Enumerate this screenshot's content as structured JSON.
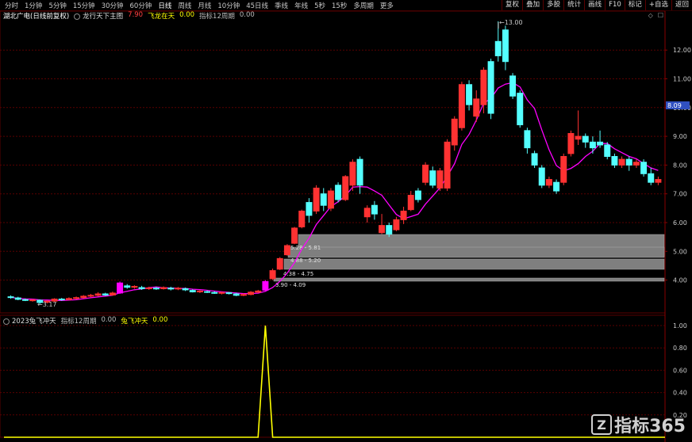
{
  "toolbar": {
    "periods": [
      "分时",
      "1分钟",
      "5分钟",
      "15分钟",
      "30分钟",
      "60分钟",
      "日线",
      "周线",
      "月线",
      "10分钟",
      "45日线",
      "季线",
      "年线",
      "5秒",
      "15秒",
      "多周期",
      "更多"
    ],
    "active_period": "日线",
    "right_buttons": [
      "复权",
      "叠加",
      "多股",
      "统计",
      "画线",
      "F10",
      "标记",
      "+自选",
      "返回"
    ]
  },
  "main_legend": {
    "stock": "湖北广电(日线前复权)",
    "indicator": "龙行天下主图",
    "val1": "7.90",
    "label2": "飞龙在天",
    "val2": "0.00",
    "label3": "指标12周期",
    "val3": "0.00"
  },
  "sub_legend": {
    "name": "2023兔飞冲天",
    "label1": "指标12周期",
    "val1": "0.00",
    "label2": "兔飞冲天",
    "val2": "0.00"
  },
  "annotations": {
    "high": "13.00",
    "low": "3.17",
    "price_tag": "8.09",
    "bar_label_1": "5.28 - 5.81",
    "bar_label_2": "4.88 - 5.20",
    "bar_label_3": "4.38 - 4.75",
    "bar_label_4": "3.90 - 4.09"
  },
  "watermark": "指标365",
  "colors": {
    "up": "#ff3232",
    "down": "#54ffff",
    "ma": "#ff00ff",
    "sub": "#ffff00",
    "grid": "#5a0000",
    "zone": "#7f7f7f"
  },
  "chart_data": [
    {
      "type": "candlestick",
      "y_ticks": [
        "12.00",
        "11.00",
        "10.00",
        "9.00",
        "8.00",
        "7.00",
        "6.00",
        "5.00",
        "4.00"
      ],
      "candles": [
        [
          3.42,
          3.4,
          3.47,
          3.35
        ],
        [
          3.38,
          3.33,
          3.42,
          3.3
        ],
        [
          3.32,
          3.3,
          3.36,
          3.27
        ],
        [
          3.29,
          3.31,
          3.34,
          3.25
        ],
        [
          3.3,
          3.22,
          3.33,
          3.17
        ],
        [
          3.23,
          3.27,
          3.3,
          3.19
        ],
        [
          3.27,
          3.34,
          3.37,
          3.24
        ],
        [
          3.34,
          3.32,
          3.38,
          3.28
        ],
        [
          3.32,
          3.36,
          3.4,
          3.3
        ],
        [
          3.36,
          3.39,
          3.43,
          3.33
        ],
        [
          3.39,
          3.44,
          3.48,
          3.36
        ],
        [
          3.44,
          3.47,
          3.52,
          3.4
        ],
        [
          3.47,
          3.52,
          3.58,
          3.43
        ],
        [
          3.52,
          3.48,
          3.56,
          3.45
        ],
        [
          3.48,
          3.55,
          3.6,
          3.46
        ],
        [
          3.55,
          3.9,
          3.95,
          3.52
        ],
        [
          3.8,
          3.75,
          3.86,
          3.7
        ],
        [
          3.75,
          3.78,
          3.82,
          3.7
        ],
        [
          3.74,
          3.7,
          3.8,
          3.66
        ],
        [
          3.7,
          3.73,
          3.77,
          3.66
        ],
        [
          3.72,
          3.7,
          3.77,
          3.66
        ],
        [
          3.7,
          3.74,
          3.78,
          3.67
        ],
        [
          3.72,
          3.69,
          3.77,
          3.64
        ],
        [
          3.69,
          3.72,
          3.76,
          3.65
        ],
        [
          3.7,
          3.66,
          3.74,
          3.62
        ],
        [
          3.64,
          3.59,
          3.68,
          3.57
        ],
        [
          3.59,
          3.62,
          3.65,
          3.55
        ],
        [
          3.6,
          3.58,
          3.64,
          3.55
        ],
        [
          3.57,
          3.54,
          3.61,
          3.52
        ],
        [
          3.54,
          3.57,
          3.6,
          3.5
        ],
        [
          3.56,
          3.53,
          3.59,
          3.5
        ],
        [
          3.52,
          3.47,
          3.56,
          3.44
        ],
        [
          3.47,
          3.5,
          3.54,
          3.44
        ],
        [
          3.5,
          3.58,
          3.62,
          3.47
        ],
        [
          3.58,
          3.62,
          3.66,
          3.55
        ],
        [
          3.65,
          3.95,
          4.0,
          3.62
        ],
        [
          4.05,
          4.33,
          4.4,
          4.0
        ],
        [
          4.38,
          4.75,
          4.8,
          4.35
        ],
        [
          4.88,
          5.2,
          5.25,
          4.85
        ],
        [
          5.28,
          5.81,
          5.85,
          5.25
        ],
        [
          5.85,
          6.4,
          6.45,
          5.8
        ],
        [
          6.7,
          6.25,
          6.85,
          6.0
        ],
        [
          6.4,
          7.2,
          7.3,
          6.3
        ],
        [
          7.0,
          6.6,
          7.2,
          6.4
        ],
        [
          6.5,
          7.1,
          7.2,
          6.4
        ],
        [
          7.3,
          6.8,
          7.4,
          6.7
        ],
        [
          6.8,
          7.6,
          7.65,
          6.75
        ],
        [
          7.3,
          8.1,
          8.2,
          7.1
        ],
        [
          8.2,
          7.3,
          8.3,
          7.0
        ],
        [
          6.2,
          6.5,
          6.6,
          6.0
        ],
        [
          6.6,
          6.3,
          6.75,
          6.1
        ],
        [
          5.65,
          5.9,
          6.3,
          5.6
        ],
        [
          5.9,
          5.6,
          6.0,
          5.5
        ],
        [
          5.75,
          6.1,
          6.2,
          5.7
        ],
        [
          6.1,
          6.4,
          6.55,
          5.95
        ],
        [
          6.45,
          6.95,
          7.1,
          6.4
        ],
        [
          7.1,
          6.8,
          7.2,
          6.7
        ],
        [
          7.4,
          8.0,
          8.1,
          7.3
        ],
        [
          7.8,
          7.3,
          7.95,
          7.2
        ],
        [
          7.2,
          7.8,
          7.9,
          7.1
        ],
        [
          7.2,
          8.8,
          8.9,
          7.1
        ],
        [
          8.7,
          9.6,
          9.7,
          8.5
        ],
        [
          9.3,
          10.8,
          10.9,
          9.2
        ],
        [
          10.8,
          10.1,
          10.95,
          9.9
        ],
        [
          9.7,
          10.3,
          10.6,
          9.5
        ],
        [
          10.1,
          11.3,
          11.4,
          9.8
        ],
        [
          11.6,
          9.8,
          11.7,
          9.6
        ],
        [
          12.3,
          11.8,
          13.0,
          11.6
        ],
        [
          12.7,
          11.6,
          12.85,
          11.3
        ],
        [
          11.1,
          10.4,
          11.2,
          10.3
        ],
        [
          10.5,
          9.4,
          10.6,
          9.3
        ],
        [
          9.2,
          8.6,
          9.3,
          8.4
        ],
        [
          8.4,
          8.0,
          8.5,
          7.9
        ],
        [
          7.9,
          7.3,
          8.0,
          7.2
        ],
        [
          7.3,
          7.5,
          7.6,
          7.2
        ],
        [
          7.4,
          7.1,
          7.5,
          7.0
        ],
        [
          7.4,
          8.3,
          8.4,
          7.3
        ],
        [
          8.4,
          9.1,
          9.2,
          8.3
        ],
        [
          8.9,
          9.0,
          9.9,
          8.7
        ],
        [
          9.0,
          8.8,
          9.1,
          8.6
        ],
        [
          8.8,
          8.6,
          9.0,
          8.4
        ],
        [
          8.8,
          8.7,
          9.2,
          8.6
        ],
        [
          8.7,
          8.3,
          8.8,
          8.2
        ],
        [
          8.3,
          8.0,
          8.4,
          7.9
        ],
        [
          8.0,
          8.2,
          8.3,
          7.9
        ],
        [
          8.2,
          8.0,
          8.3,
          7.8
        ],
        [
          8.0,
          8.1,
          8.2,
          7.9
        ],
        [
          8.1,
          7.7,
          8.2,
          7.6
        ],
        [
          7.7,
          7.4,
          7.9,
          7.3
        ],
        [
          7.4,
          7.5,
          7.6,
          7.3
        ]
      ]
    },
    {
      "type": "line",
      "y_ticks": [
        "1.00",
        "0.80",
        "0.60",
        "0.40",
        "0.20"
      ],
      "values": [
        0,
        0,
        0,
        0,
        0,
        0,
        0,
        0,
        0,
        0,
        0,
        0,
        0,
        0,
        0,
        0,
        0,
        0,
        0,
        0,
        0,
        0,
        0,
        0,
        0,
        0,
        0,
        0,
        0,
        0,
        0,
        0,
        0,
        0,
        0,
        1,
        0,
        0,
        0,
        0,
        0,
        0,
        0,
        0,
        0,
        0,
        0,
        0,
        0,
        0,
        0,
        0,
        0,
        0,
        0,
        0,
        0,
        0,
        0,
        0,
        0,
        0,
        0,
        0,
        0,
        0,
        0,
        0,
        0,
        0,
        0,
        0,
        0,
        0,
        0,
        0,
        0,
        0,
        0,
        0,
        0,
        0,
        0,
        0,
        0,
        0,
        0,
        0,
        0,
        0
      ]
    }
  ]
}
